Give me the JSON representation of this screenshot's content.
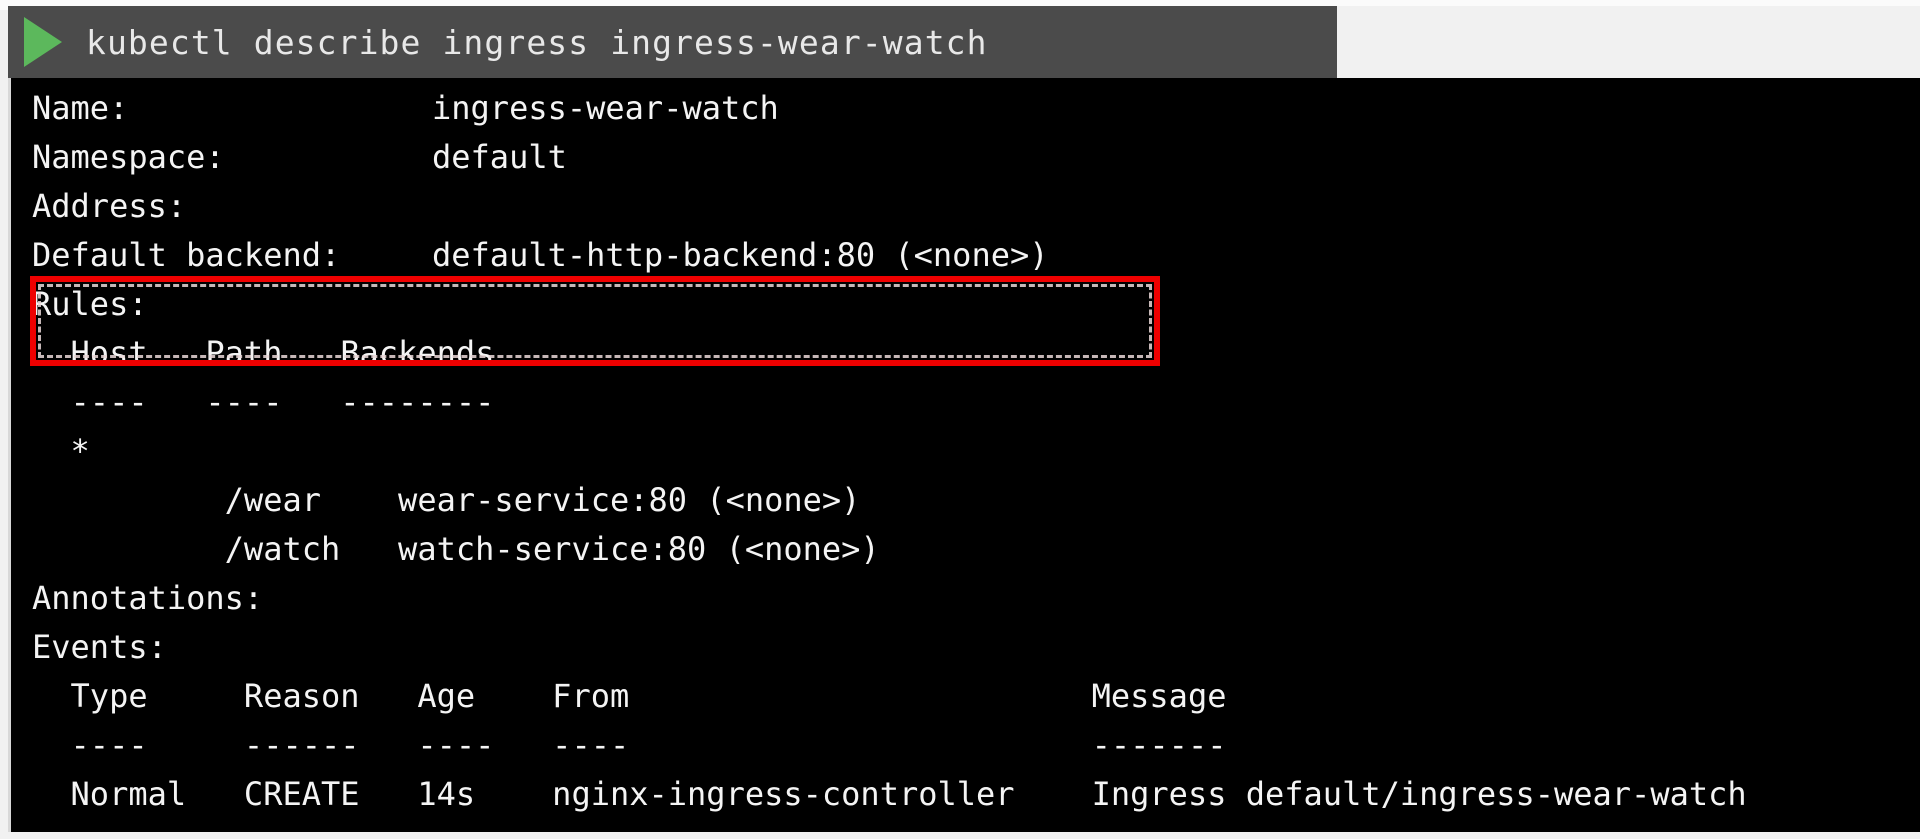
{
  "window": {
    "background_color": "#f1f1f1",
    "terminal_background": "#000000",
    "command_bar_color": "#4b4b4b",
    "text_color": "#f4f4f4",
    "highlight_color": "#ee0000",
    "prompt_icon_color": "#5cb85c"
  },
  "command_bar": {
    "prompt_icon": "play-triangle-icon",
    "command": "kubectl describe ingress ingress-wear-watch"
  },
  "terminal": {
    "lines": [
      {
        "label": "Name:",
        "value": "ingress-wear-watch"
      },
      {
        "label": "Namespace:",
        "value": "default"
      },
      {
        "label": "Address:",
        "value": ""
      },
      {
        "label": "Default backend:",
        "value": "default-http-backend:80 (<none>)"
      },
      {
        "label": "Rules:",
        "value": ""
      },
      {
        "label": "",
        "value": ""
      },
      {
        "label": "",
        "value": ""
      },
      {
        "label": "",
        "value": ""
      },
      {
        "label": "",
        "value": ""
      },
      {
        "label": "",
        "value": ""
      },
      {
        "label": "Annotations:",
        "value": ""
      },
      {
        "label": "Events:",
        "value": ""
      }
    ],
    "rules_table": {
      "headers": "  Host   Path   Backends",
      "separator": "  ----   ----   --------",
      "host_row": "  *",
      "rows": [
        "          /wear    wear-service:80 (<none>)",
        "          /watch   watch-service:80 (<none>)"
      ]
    },
    "events_table": {
      "headers": "  Type     Reason   Age    From                        Message",
      "separator": "  ----     ------   ----   ----                        -------",
      "rows": [
        "  Normal   CREATE   14s    nginx-ingress-controller    Ingress default/ingress-wear-watch"
      ]
    },
    "highlight": {
      "target_line": "Default backend:  default-http-backend:80 (<none>)",
      "style": "red-solid-with-white-dashed-inner"
    }
  }
}
